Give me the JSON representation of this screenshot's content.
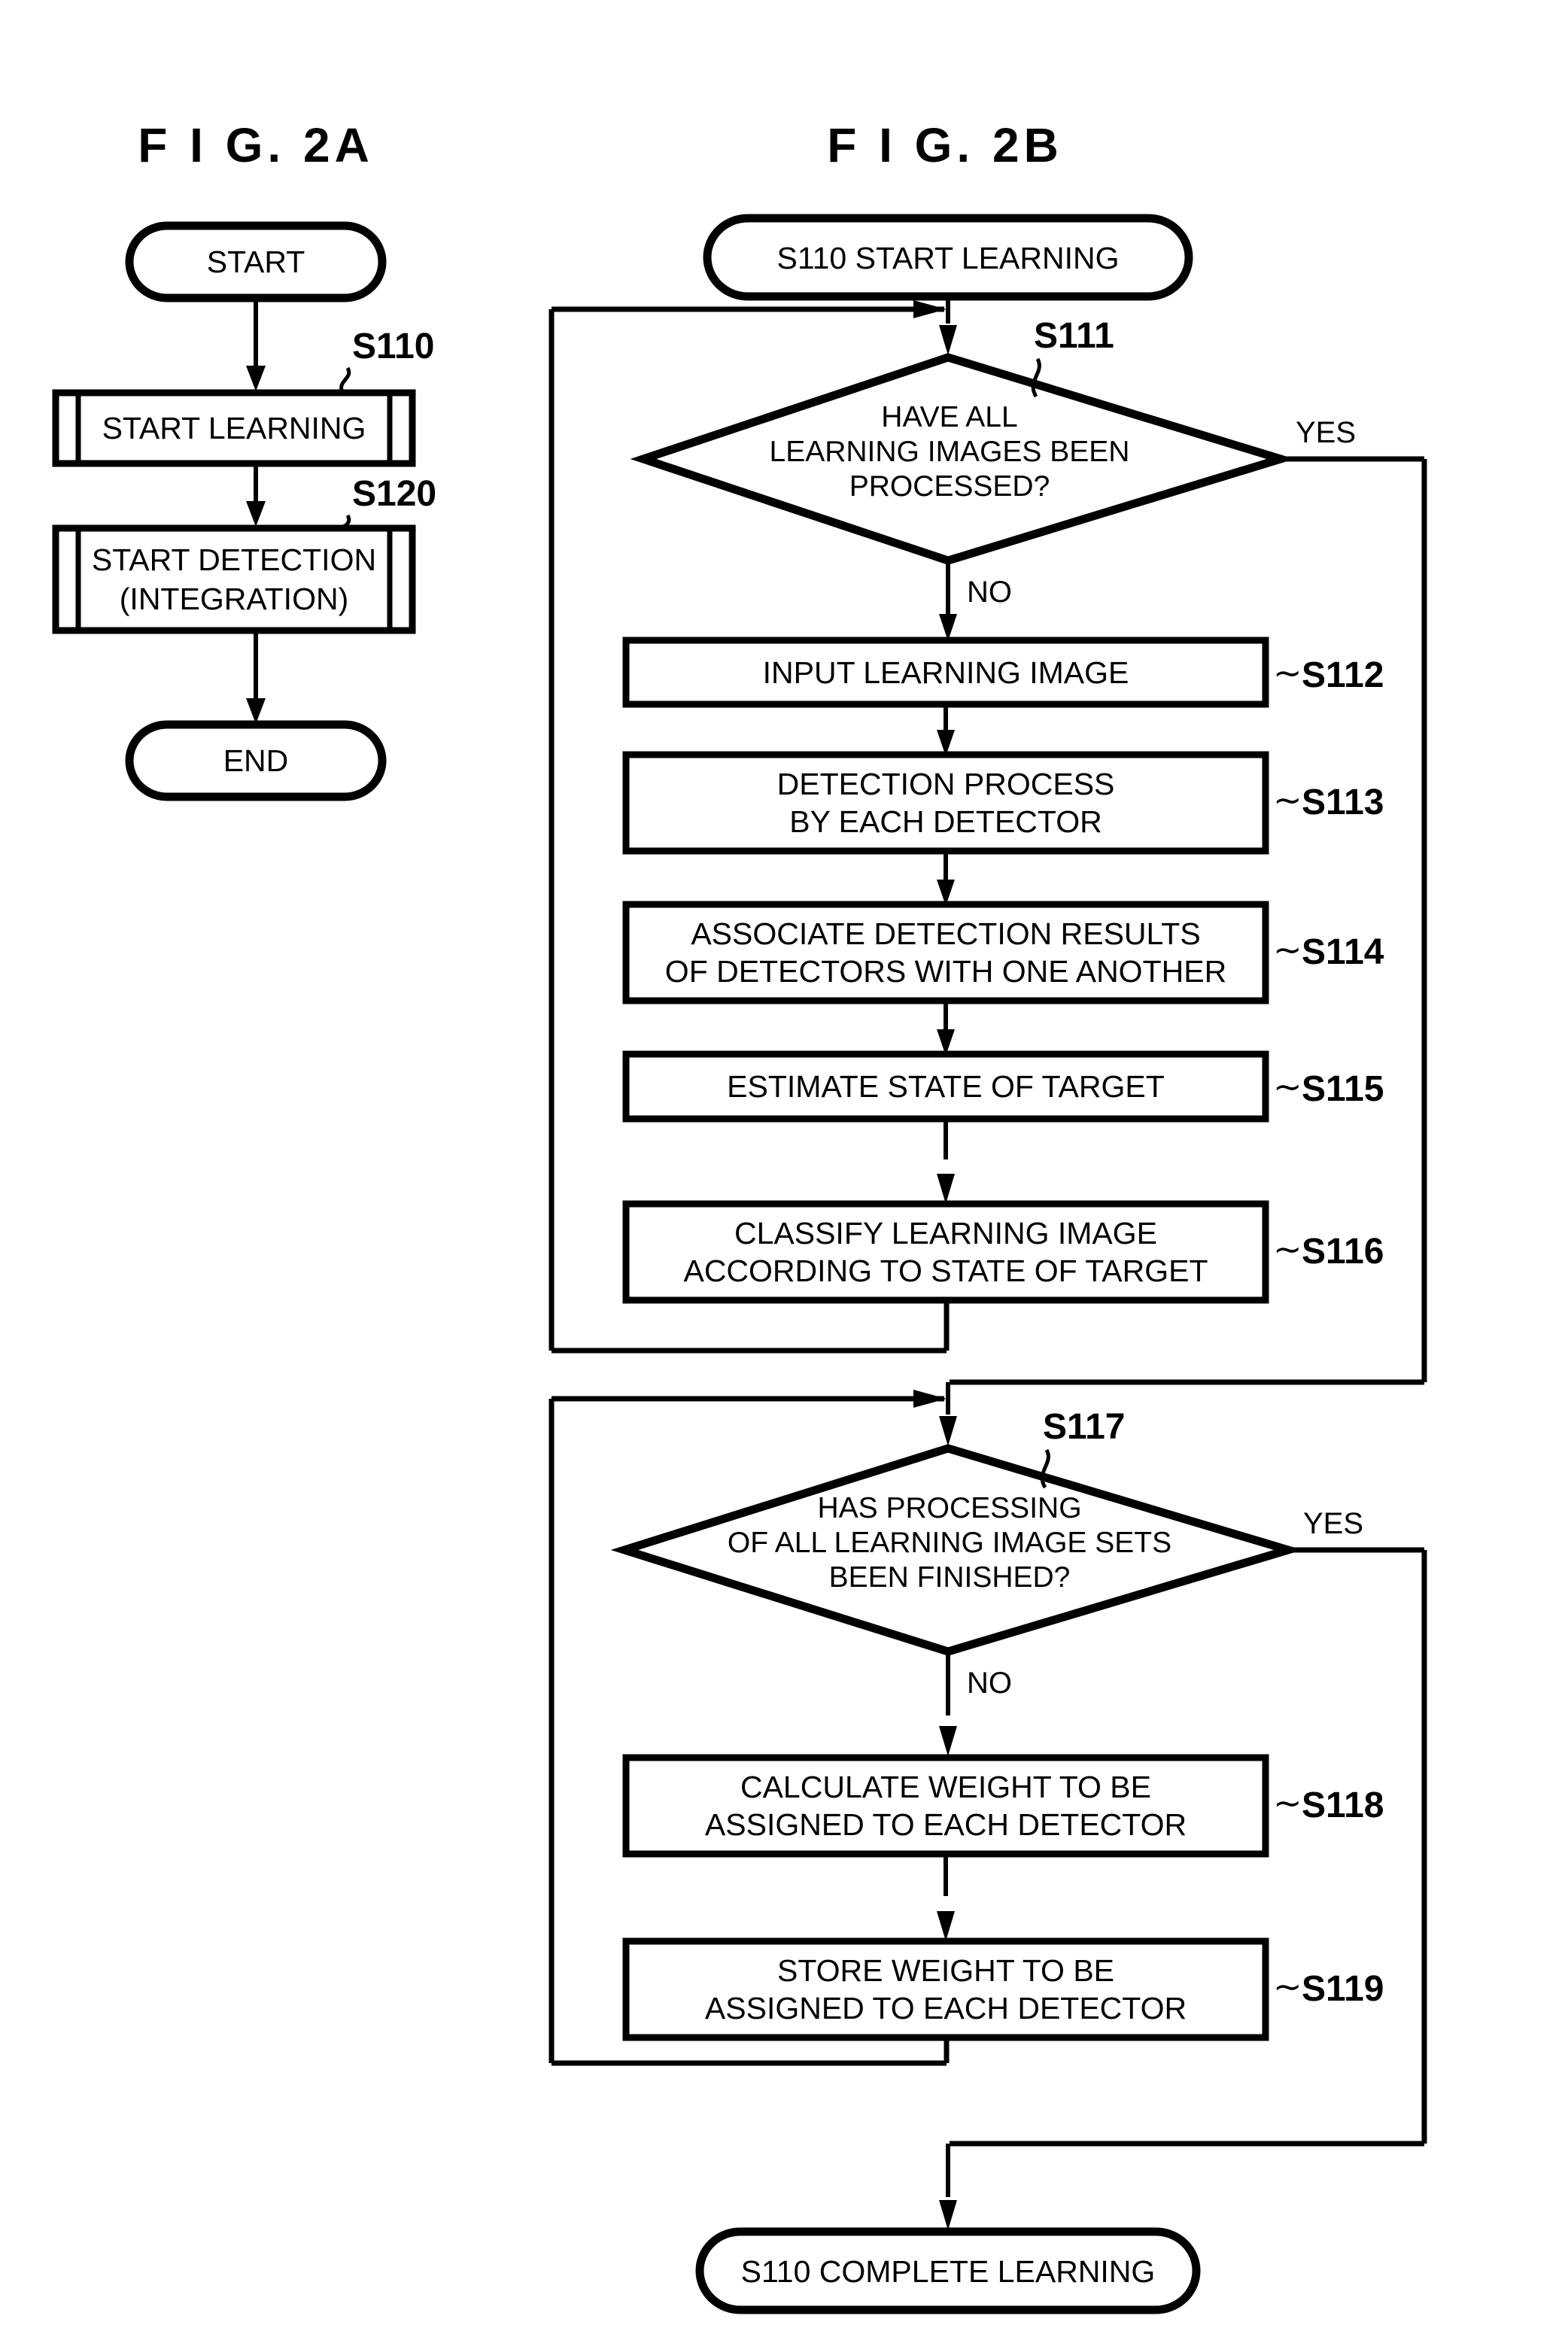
{
  "figures": [
    {
      "id": "fig-2a",
      "title": "F I G.  2A",
      "nodes": [
        {
          "id": "a-start",
          "type": "terminator",
          "label": "START"
        },
        {
          "id": "a-s110",
          "type": "subroutine",
          "label": "START LEARNING",
          "step": "S110"
        },
        {
          "id": "a-s120",
          "type": "subroutine",
          "label_line1": "START DETECTION",
          "label_line2": "(INTEGRATION)",
          "step": "S120"
        },
        {
          "id": "a-end",
          "type": "terminator",
          "label": "END"
        }
      ]
    },
    {
      "id": "fig-2b",
      "title": "F I G.  2B",
      "nodes": [
        {
          "id": "b-start",
          "type": "terminator",
          "label": "S110 START LEARNING"
        },
        {
          "id": "b-s111",
          "type": "decision",
          "step": "S111",
          "label_line1": "HAVE ALL",
          "label_line2": "LEARNING IMAGES BEEN",
          "label_line3": "PROCESSED?",
          "yes_label": "YES",
          "no_label": "NO"
        },
        {
          "id": "b-s112",
          "type": "process",
          "step": "S112",
          "label_line1": "INPUT LEARNING IMAGE"
        },
        {
          "id": "b-s113",
          "type": "process",
          "step": "S113",
          "label_line1": "DETECTION PROCESS",
          "label_line2": "BY EACH DETECTOR"
        },
        {
          "id": "b-s114",
          "type": "process",
          "step": "S114",
          "label_line1": "ASSOCIATE DETECTION RESULTS",
          "label_line2": "OF DETECTORS WITH ONE ANOTHER"
        },
        {
          "id": "b-s115",
          "type": "process",
          "step": "S115",
          "label_line1": "ESTIMATE STATE OF TARGET"
        },
        {
          "id": "b-s116",
          "type": "process",
          "step": "S116",
          "label_line1": "CLASSIFY LEARNING IMAGE",
          "label_line2": "ACCORDING TO STATE OF TARGET"
        },
        {
          "id": "b-s117",
          "type": "decision",
          "step": "S117",
          "label_line1": "HAS PROCESSING",
          "label_line2": "OF ALL LEARNING IMAGE SETS",
          "label_line3": "BEEN FINISHED?",
          "yes_label": "YES",
          "no_label": "NO"
        },
        {
          "id": "b-s118",
          "type": "process",
          "step": "S118",
          "label_line1": "CALCULATE WEIGHT TO BE",
          "label_line2": "ASSIGNED TO EACH DETECTOR"
        },
        {
          "id": "b-s119",
          "type": "process",
          "step": "S119",
          "label_line1": "STORE WEIGHT TO BE",
          "label_line2": "ASSIGNED TO EACH DETECTOR"
        },
        {
          "id": "b-end",
          "type": "terminator",
          "label": "S110 COMPLETE LEARNING"
        }
      ]
    }
  ],
  "tilde": "∼",
  "colors": {
    "ink": "#000000",
    "paper": "#ffffff"
  }
}
